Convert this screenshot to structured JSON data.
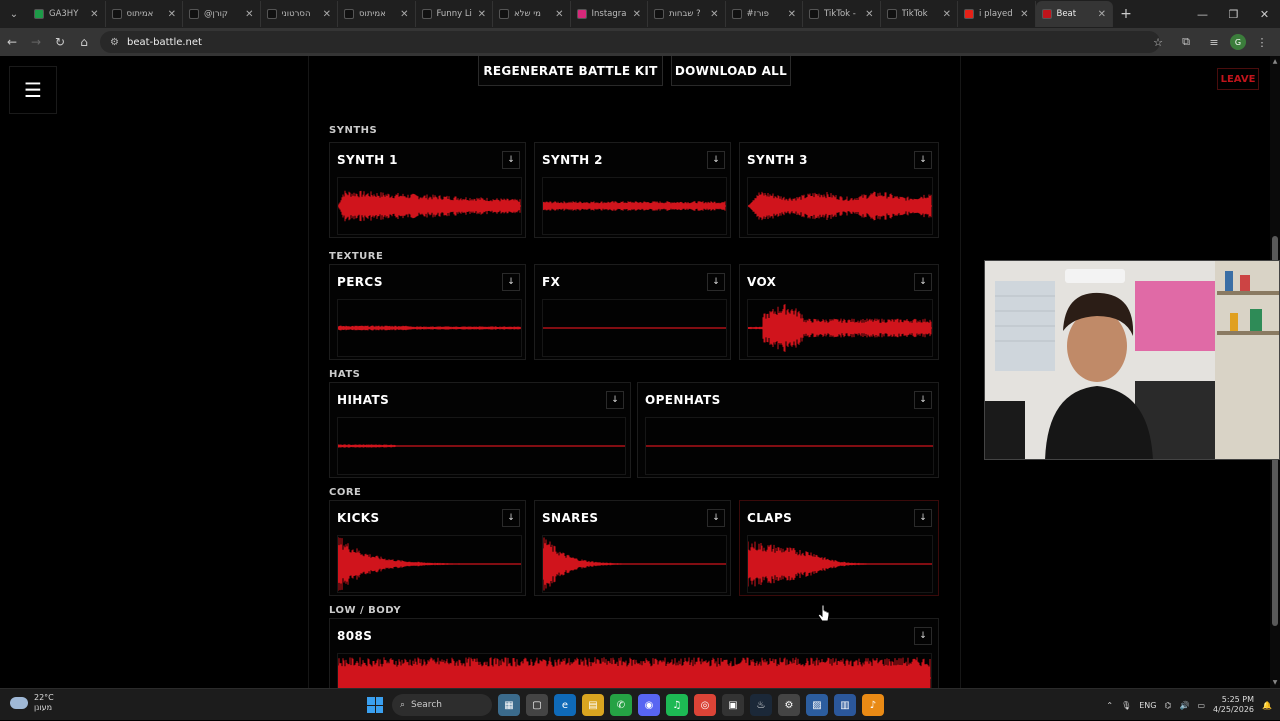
{
  "browser": {
    "tabs": [
      {
        "title": "GA3HY",
        "icon": "excel-green-icon"
      },
      {
        "title": "אמיתוס",
        "icon": "tiktok-icon"
      },
      {
        "title": "@קורן",
        "icon": "tiktok-icon"
      },
      {
        "title": "הסרטוני",
        "icon": "tiktok-icon"
      },
      {
        "title": "אמיתוס",
        "icon": "tiktok-icon"
      },
      {
        "title": "Funny Li",
        "icon": "tiktok-icon"
      },
      {
        "title": "מי שלא",
        "icon": "tiktok-icon"
      },
      {
        "title": "Instagra",
        "icon": "instagram-icon"
      },
      {
        "title": "שבחות ?",
        "icon": "tiktok-icon"
      },
      {
        "title": "#פורז",
        "icon": "tiktok-icon"
      },
      {
        "title": "TikTok -",
        "icon": "tiktok-icon"
      },
      {
        "title": "TikTok",
        "icon": "tiktok-icon"
      },
      {
        "title": "i played",
        "icon": "youtube-icon"
      },
      {
        "title": "Beat",
        "icon": "beat-battle-icon",
        "active": true
      }
    ],
    "url": "beat-battle.net",
    "profile_initial": "G"
  },
  "page": {
    "leave_label": "LEAVE",
    "regenerate_label": "REGENERATE BATTLE KIT",
    "download_all_label": "DOWNLOAD ALL",
    "download_glyph": "↓",
    "sections": {
      "synths": "SYNTHS",
      "texture": "TEXTURE",
      "hats": "HATS",
      "core": "CORE",
      "low_body": "LOW / BODY"
    },
    "cards": {
      "synth1": "SYNTH 1",
      "synth2": "SYNTH 2",
      "synth3": "SYNTH 3",
      "percs": "PERCS",
      "fx": "FX",
      "vox": "VOX",
      "hihats": "HIHATS",
      "openhats": "OPENHATS",
      "kicks": "KICKS",
      "snares": "SNARES",
      "claps": "CLAPS",
      "bass808": "808S"
    },
    "wave_color": "#d0141c"
  },
  "taskbar": {
    "temperature": "22°C",
    "weather_text": "מעונן",
    "search_label": "Search",
    "lang": "ENG",
    "time": "5:25 PM",
    "date": "4/25/2026"
  }
}
